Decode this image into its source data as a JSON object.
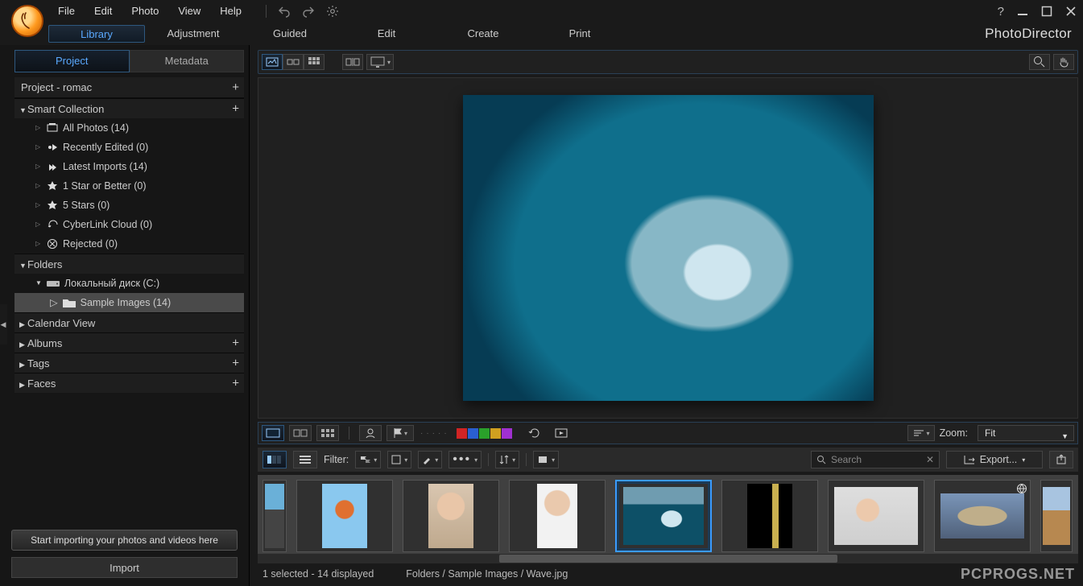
{
  "menu": {
    "file": "File",
    "edit": "Edit",
    "photo": "Photo",
    "view": "View",
    "help": "Help"
  },
  "tabs": {
    "library": "Library",
    "adjustment": "Adjustment",
    "guided": "Guided",
    "edit": "Edit",
    "create": "Create",
    "print": "Print"
  },
  "brand": "PhotoDirector",
  "left_tabs": {
    "project": "Project",
    "metadata": "Metadata"
  },
  "project_title": "Project - romac",
  "smart_collection": {
    "title": "Smart Collection",
    "items": [
      "All Photos (14)",
      "Recently Edited (0)",
      "Latest Imports (14)",
      "1 Star or Better (0)",
      "5 Stars (0)",
      "CyberLink Cloud (0)",
      "Rejected (0)"
    ]
  },
  "folders": {
    "title": "Folders",
    "drive": "Локальный диск (C:)",
    "selected": "Sample Images (14)"
  },
  "sections": {
    "calendar": "Calendar View",
    "albums": "Albums",
    "tags": "Tags",
    "faces": "Faces"
  },
  "tooltip": "Start importing your photos and videos here",
  "import": "Import",
  "zoom": {
    "label": "Zoom:",
    "value": "Fit"
  },
  "filter": {
    "label": "Filter:"
  },
  "search": {
    "placeholder": "Search"
  },
  "export": {
    "label": "Export..."
  },
  "swatches": [
    "#d02424",
    "#2a5fd0",
    "#2aa02a",
    "#d0a020",
    "#a030d0"
  ],
  "status": {
    "sel": "1 selected - 14 displayed",
    "path": "Folders / Sample Images / Wave.jpg"
  },
  "watermark": "PCPROGS.NET"
}
